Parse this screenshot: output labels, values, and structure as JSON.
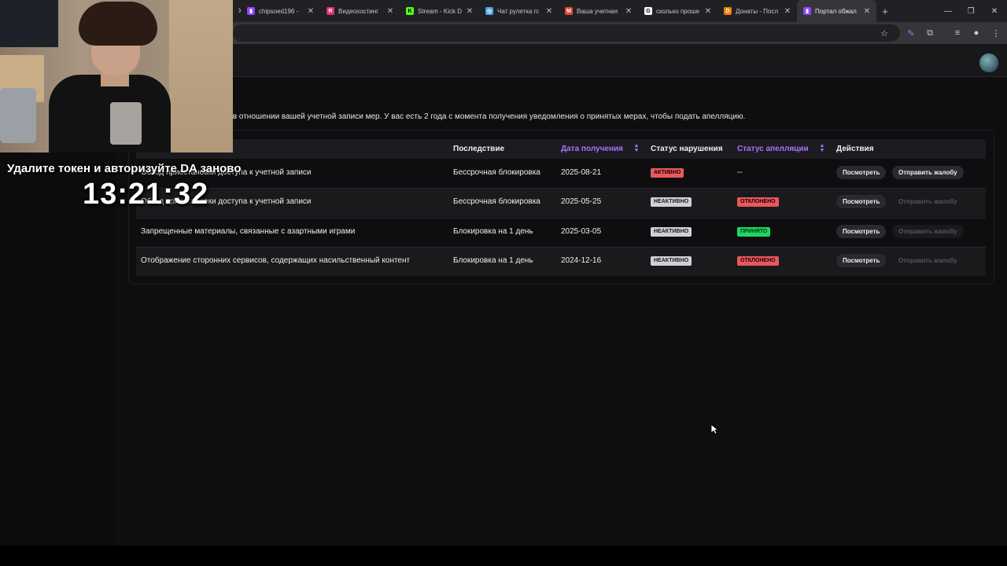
{
  "browser": {
    "tabs": [
      {
        "title": "chipsoed196 -",
        "favicon_color": "#9146ff",
        "favicon_glyph": "▮"
      },
      {
        "title": "Видеохостинг",
        "favicon_color": "#e1306c",
        "favicon_glyph": "R"
      },
      {
        "title": "Stream - Kick D",
        "favicon_color": "#53fc18",
        "favicon_glyph": "K"
      },
      {
        "title": "Чат рулетка гс",
        "favicon_color": "#4aa3df",
        "favicon_glyph": "◎"
      },
      {
        "title": "Ваша учетная",
        "favicon_color": "#ea4335",
        "favicon_glyph": "M"
      },
      {
        "title": "сколько проше",
        "favicon_color": "#ffffff",
        "favicon_glyph": "G"
      },
      {
        "title": "Донаты - Посл",
        "favicon_color": "#f57c00",
        "favicon_glyph": "D"
      },
      {
        "title": "Портал обжал",
        "favicon_color": "#9146ff",
        "favicon_glyph": "▮",
        "active": true
      }
    ],
    "new_tab": "+",
    "window_controls": {
      "minimize": "—",
      "restore": "❐",
      "close": "✕"
    }
  },
  "page": {
    "intro_text": "х в отношении вашей учетной записи мер. У вас есть 2 года с момента получения уведомления о принятых мерах, чтобы подать апелляцию."
  },
  "table": {
    "headers": {
      "consequence": "Последствие",
      "date": "Дата получения",
      "violation_status": "Статус нарушения",
      "appeal_status": "Статус апелляции",
      "actions": "Действия"
    },
    "rows": [
      {
        "reason": "Обход приостановки доступа к учетной записи",
        "consequence": "Бессрочная блокировка",
        "date": "2025-08-21",
        "violation_status": "Активно",
        "violation_color": "red",
        "appeal_status": "--",
        "appeal_color": "",
        "view": "Посмотреть",
        "appeal": "Отправить жалобу",
        "appeal_enabled": true
      },
      {
        "reason": "Обход приостановки доступа к учетной записи",
        "consequence": "Бессрочная блокировка",
        "date": "2025-05-25",
        "violation_status": "Неактивно",
        "violation_color": "gray",
        "appeal_status": "Отклонено",
        "appeal_color": "red",
        "view": "Посмотреть",
        "appeal": "Отправить жалобу",
        "appeal_enabled": false
      },
      {
        "reason": "Запрещенные материалы, связанные с азартными играми",
        "consequence": "Блокировка на 1 день",
        "date": "2025-03-05",
        "violation_status": "Неактивно",
        "violation_color": "gray",
        "appeal_status": "Принято",
        "appeal_color": "green",
        "view": "Посмотреть",
        "appeal": "Отправить жалобу",
        "appeal_enabled": false
      },
      {
        "reason": "Отображение сторонних сервисов, содержащих насильственный контент",
        "consequence": "Блокировка на 1 день",
        "date": "2024-12-16",
        "violation_status": "Неактивно",
        "violation_color": "gray",
        "appeal_status": "Отклонено",
        "appeal_color": "red",
        "view": "Посмотреть",
        "appeal": "Отправить жалобу",
        "appeal_enabled": false
      }
    ]
  },
  "overlay": {
    "message": "Удалите токен и авторизуйте DA заново",
    "time": "13:21:32"
  },
  "colors": {
    "accent_purple": "#a970ff",
    "badge_red": "#e8585c",
    "badge_green": "#1ed760",
    "badge_gray": "#d0d0d6"
  }
}
